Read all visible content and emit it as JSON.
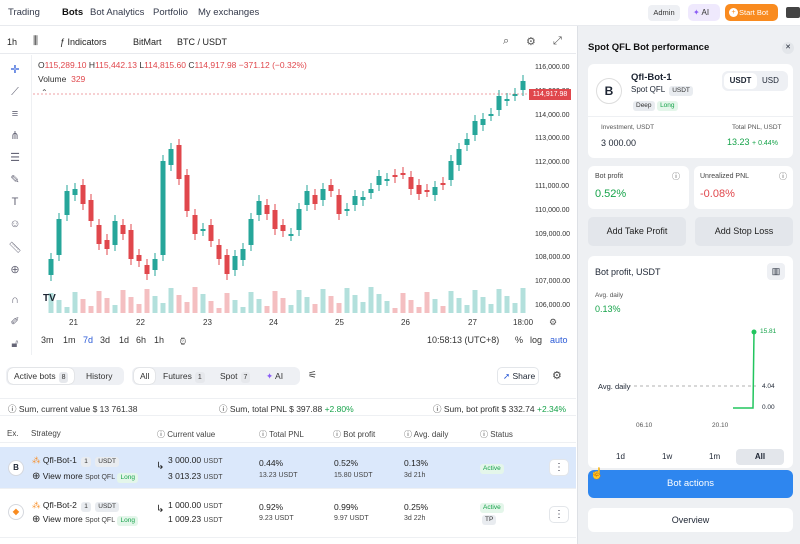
{
  "nav": {
    "items": [
      "Trading",
      "Bots",
      "Bot Analytics",
      "Portfolio",
      "My exchanges"
    ],
    "admin": "Admin",
    "ai": "AI",
    "start_bot": "Start Bot"
  },
  "toolbar": {
    "interval": "1h",
    "indicators": "Indicators",
    "exchange": "BitMart",
    "pair": "BTC / USDT"
  },
  "chart": {
    "ohlc": {
      "o": "115,289.10",
      "h": "115,442.13",
      "l": "114,815.60",
      "c": "114,917.98",
      "chg": "−371.12 (−0.32%)"
    },
    "volume_label": "Volume",
    "volume_value": "329",
    "last_price": "114,917.98",
    "y_ticks": [
      "116,000.00",
      "115,000.00",
      "114,000.00",
      "113,000.00",
      "112,000.00",
      "111,000.00",
      "110,000.00",
      "109,000.00",
      "108,000.00",
      "107,000.00",
      "106,000.00"
    ],
    "x_ticks": [
      "21",
      "22",
      "23",
      "24",
      "25",
      "26",
      "27",
      "18:00"
    ],
    "ranges": [
      "3m",
      "1m",
      "7d",
      "3d",
      "1d",
      "6h",
      "1h"
    ],
    "active_range": "7d",
    "clock": "10:58:13 (UTC+8)",
    "pct": "%",
    "log": "log",
    "auto": "auto"
  },
  "filters": {
    "active": "Active bots",
    "active_count": "8",
    "history": "History",
    "all": "All",
    "futures": "Futures",
    "futures_count": "1",
    "spot": "Spot",
    "spot_count": "7",
    "ai": "AI",
    "share": "Share"
  },
  "sums": {
    "current": "Sum, current value",
    "current_val": "$ 13 761.38",
    "pnl": "Sum, total PNL",
    "pnl_val": "$ 397.88",
    "pnl_pct": "+2.80%",
    "profit": "Sum, bot profit",
    "profit_val": "$ 332.74",
    "profit_pct": "+2.34%"
  },
  "table": {
    "headers": [
      "Ex.",
      "Strategy",
      "Current value",
      "Total PNL",
      "Bot profit",
      "Avg. daily",
      "Status"
    ],
    "rows": [
      {
        "name": "Qfl-Bot-1",
        "num": "1",
        "quote": "USDT",
        "view": "View more",
        "type": "Spot QFL",
        "dir": "Long",
        "cur1": "3 000.00",
        "cur1u": "USDT",
        "cur2": "3 013.23",
        "cur2u": "USDT",
        "pnl_pct": "0.44%",
        "pnl_abs": "13.23",
        "pnl_u": "USDT",
        "bp_pct": "0.52%",
        "bp_abs": "15.80",
        "bp_u": "USDT",
        "avg": "0.13%",
        "age": "3d 21h",
        "status": "Active",
        "coin": "B"
      },
      {
        "name": "Qfl-Bot-2",
        "num": "1",
        "quote": "USDT",
        "view": "View more",
        "type": "Spot QFL",
        "dir": "Long",
        "cur1": "1 000.00",
        "cur1u": "USDT",
        "cur2": "1 009.23",
        "cur2u": "USDT",
        "pnl_pct": "0.92%",
        "pnl_abs": "9.23",
        "pnl_u": "USDT",
        "bp_pct": "0.99%",
        "bp_abs": "9.97",
        "bp_u": "USDT",
        "avg": "0.25%",
        "age": "3d 22h",
        "status": "Active",
        "status2": "TP",
        "coin": "◆"
      }
    ]
  },
  "panel": {
    "title": "Spot QFL Bot performance",
    "bot_name": "Qfl-Bot-1",
    "bot_type": "Spot QFL",
    "bot_quote": "USDT",
    "tag_deep": "Deep",
    "tag_long": "Long",
    "cur_usdt": "USDT",
    "cur_usd": "USD",
    "investment_label": "Investment, USDT",
    "investment": "3 000.00",
    "pnl_label": "Total PNL, USDT",
    "pnl": "13.23",
    "pnl_pct": "+ 0.44%",
    "bot_profit_label": "Bot profit",
    "bot_profit": "0.52%",
    "unreal_label": "Unrealized PNL",
    "unreal": "-0.08%",
    "take_profit": "Add Take Profit",
    "stop_loss": "Add Stop Loss",
    "profit_chart_title": "Bot profit, USDT",
    "avg_daily_label": "Avg. daily",
    "avg_daily_val": "0.13%",
    "profit_y": [
      "15.81",
      "4.04",
      "0.00"
    ],
    "avg_line_label": "Avg. daily",
    "profit_x": [
      "06.10",
      "20.10"
    ],
    "periods": [
      "1d",
      "1w",
      "1m",
      "All"
    ],
    "active_period": "All",
    "bot_actions": "Bot actions",
    "overview": "Overview"
  },
  "colors": {
    "up": "#26a69a",
    "down": "#e0474c",
    "accent": "#2e86ef",
    "orange": "#f98b1f",
    "green": "#16a34a"
  }
}
